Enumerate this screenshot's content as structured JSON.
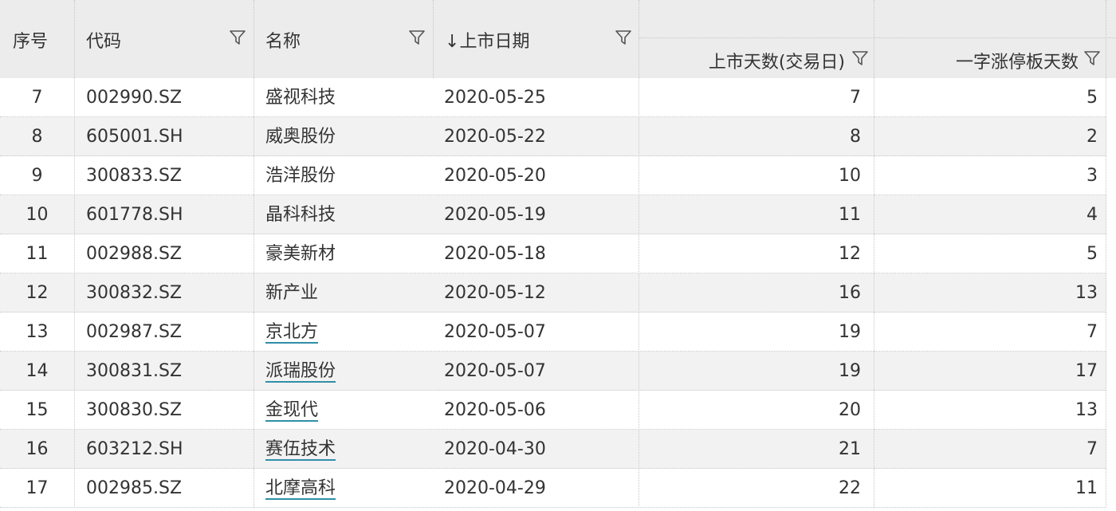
{
  "columns": {
    "index": "序号",
    "code": "代码",
    "name": "名称",
    "listing_date": "上市日期",
    "sort_arrow": "↓",
    "listing_days": "上市天数(交易日)",
    "limit_up_days": "一字涨停板天数"
  },
  "sort": {
    "column": "listing_date",
    "direction": "desc"
  },
  "colors": {
    "header_bg": "#ececec",
    "alt_row_bg": "#f2f2f2",
    "link_underline": "#2f8fa8"
  },
  "rows": [
    {
      "index": "7",
      "code": "002990.SZ",
      "name": "盛视科技",
      "date": "2020-05-25",
      "days": "7",
      "limit": "5",
      "linked": false
    },
    {
      "index": "8",
      "code": "605001.SH",
      "name": "威奥股份",
      "date": "2020-05-22",
      "days": "8",
      "limit": "2",
      "linked": false
    },
    {
      "index": "9",
      "code": "300833.SZ",
      "name": "浩洋股份",
      "date": "2020-05-20",
      "days": "10",
      "limit": "3",
      "linked": false
    },
    {
      "index": "10",
      "code": "601778.SH",
      "name": "晶科科技",
      "date": "2020-05-19",
      "days": "11",
      "limit": "4",
      "linked": false
    },
    {
      "index": "11",
      "code": "002988.SZ",
      "name": "豪美新材",
      "date": "2020-05-18",
      "days": "12",
      "limit": "5",
      "linked": false
    },
    {
      "index": "12",
      "code": "300832.SZ",
      "name": "新产业",
      "date": "2020-05-12",
      "days": "16",
      "limit": "13",
      "linked": false
    },
    {
      "index": "13",
      "code": "002987.SZ",
      "name": "京北方",
      "date": "2020-05-07",
      "days": "19",
      "limit": "7",
      "linked": true
    },
    {
      "index": "14",
      "code": "300831.SZ",
      "name": "派瑞股份",
      "date": "2020-05-07",
      "days": "19",
      "limit": "17",
      "linked": true
    },
    {
      "index": "15",
      "code": "300830.SZ",
      "name": "金现代",
      "date": "2020-05-06",
      "days": "20",
      "limit": "13",
      "linked": true
    },
    {
      "index": "16",
      "code": "603212.SH",
      "name": "赛伍技术",
      "date": "2020-04-30",
      "days": "21",
      "limit": "7",
      "linked": true
    },
    {
      "index": "17",
      "code": "002985.SZ",
      "name": "北摩高科",
      "date": "2020-04-29",
      "days": "22",
      "limit": "11",
      "linked": true
    }
  ]
}
